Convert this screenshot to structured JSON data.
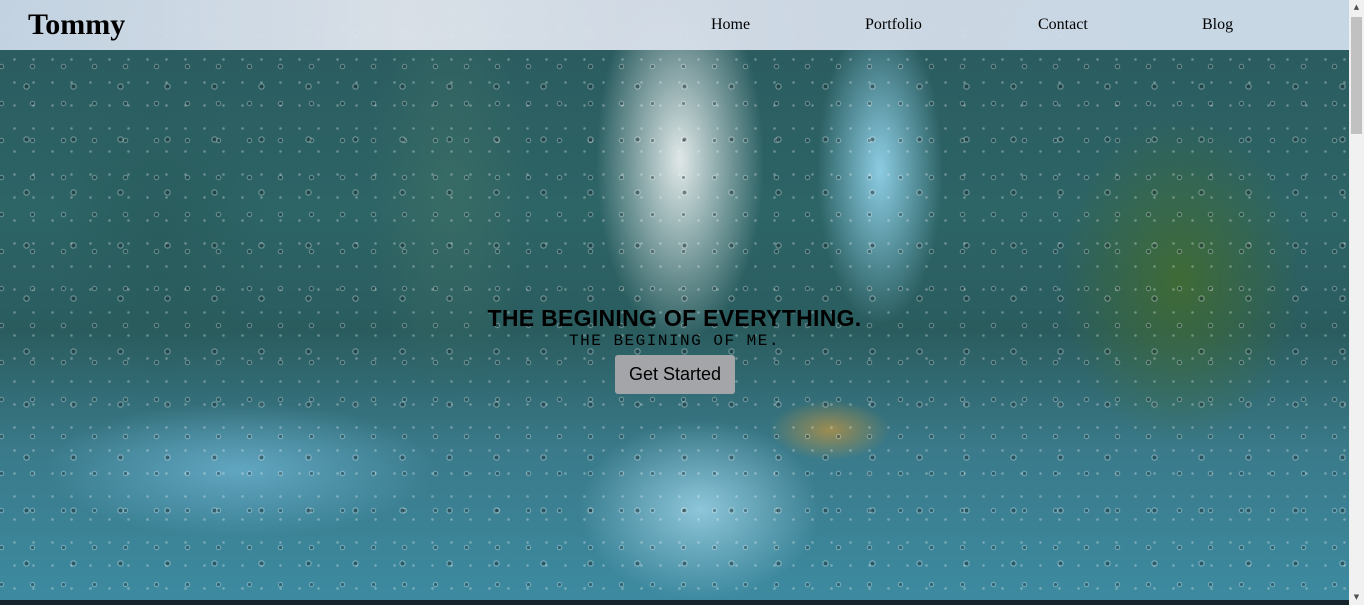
{
  "header": {
    "logo": "Tommy",
    "nav": [
      {
        "label": "Home"
      },
      {
        "label": "Portfolio"
      },
      {
        "label": "Contact"
      },
      {
        "label": "Blog"
      }
    ]
  },
  "hero": {
    "headline": "THE BEGINING OF EVERYTHING.",
    "subline": "THE BEGINING OF ME.",
    "cta_label": "Get Started",
    "background_image": "rain-on-window-city-blur"
  },
  "scrollbar": {
    "up_icon": "chevron-up-icon",
    "down_icon": "chevron-down-icon"
  },
  "colors": {
    "header_bg": "#d5dee8",
    "cta_bg": "#a3a5a8",
    "text": "#000000"
  }
}
